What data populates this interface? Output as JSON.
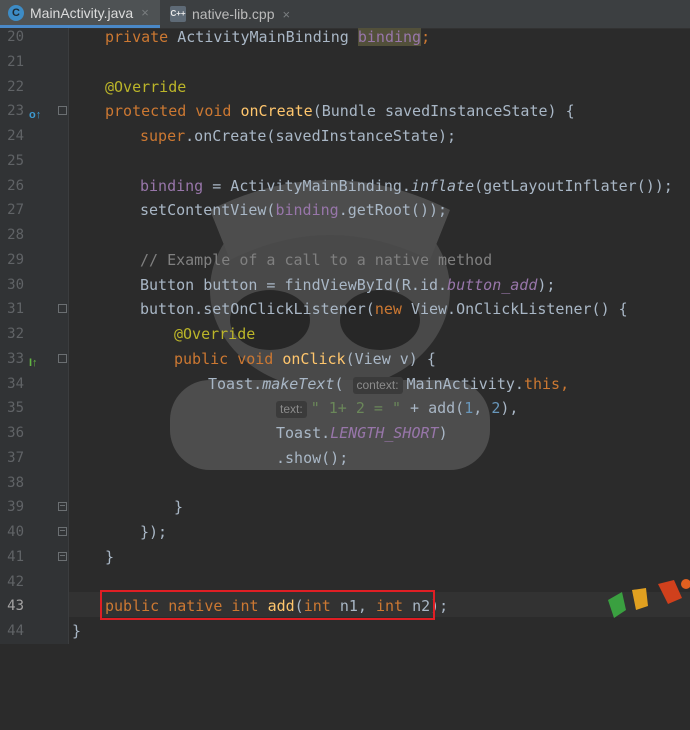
{
  "tabs": [
    {
      "label": "MainActivity.java",
      "icon": "C",
      "close": "×",
      "active": true
    },
    {
      "label": "native-lib.cpp",
      "icon": "C++",
      "close": "×",
      "active": false
    }
  ],
  "line_numbers": [
    "20",
    "21",
    "22",
    "23",
    "24",
    "25",
    "26",
    "27",
    "28",
    "29",
    "30",
    "31",
    "32",
    "33",
    "34",
    "35",
    "36",
    "37",
    "38",
    "39",
    "40",
    "41",
    "42",
    "43",
    "44"
  ],
  "current_line": "43",
  "code": {
    "l20": [
      "private ",
      "ActivityMainBinding ",
      "binding",
      ";"
    ],
    "l22": [
      "@Override"
    ],
    "l23": [
      "protected void ",
      "onCreate",
      "(Bundle savedInstanceState) {"
    ],
    "l24": [
      "super",
      ".onCreate(savedInstanceState);"
    ],
    "l26": [
      "binding",
      " = ActivityMainBinding.",
      "inflate",
      "(getLayoutInflater());"
    ],
    "l27": [
      "setContentView(",
      "binding",
      ".getRoot());"
    ],
    "l29": [
      "// Example of a call to a native method"
    ],
    "l30": [
      "Button button = findViewById(R.id.",
      "button_add",
      ");"
    ],
    "l31": [
      "button.setOnClickListener(",
      "new ",
      "View.OnClickListener() {"
    ],
    "l32": [
      "@Override"
    ],
    "l33": [
      "public void ",
      "onClick",
      "(View v) {"
    ],
    "l34": [
      "Toast.",
      "makeText",
      "(",
      "context:",
      "MainActivity.",
      "this",
      ","
    ],
    "l35": [
      "text:",
      "\" 1+ 2 = \"",
      " + add(",
      "1",
      ", ",
      "2",
      "),"
    ],
    "l36": [
      "Toast.",
      "LENGTH_SHORT",
      ")"
    ],
    "l37": [
      ".show();"
    ],
    "l39": [
      "}"
    ],
    "l40": [
      "});"
    ],
    "l41": [
      "}"
    ],
    "l43": [
      "public native int ",
      "add",
      "(",
      "int ",
      "n1, ",
      "int ",
      "n2);"
    ],
    "l44": [
      "}"
    ]
  },
  "gutter_icons": {
    "l23": "override-method-icon",
    "l33": "implement-method-icon"
  },
  "colors": {
    "background": "#2b2b2b",
    "keyword": "#cc7832",
    "annotation": "#bbb529",
    "method": "#ffc66d",
    "field": "#9876aa",
    "number": "#6897bb",
    "string": "#6a8759",
    "highlight_box": "#e01e24"
  }
}
